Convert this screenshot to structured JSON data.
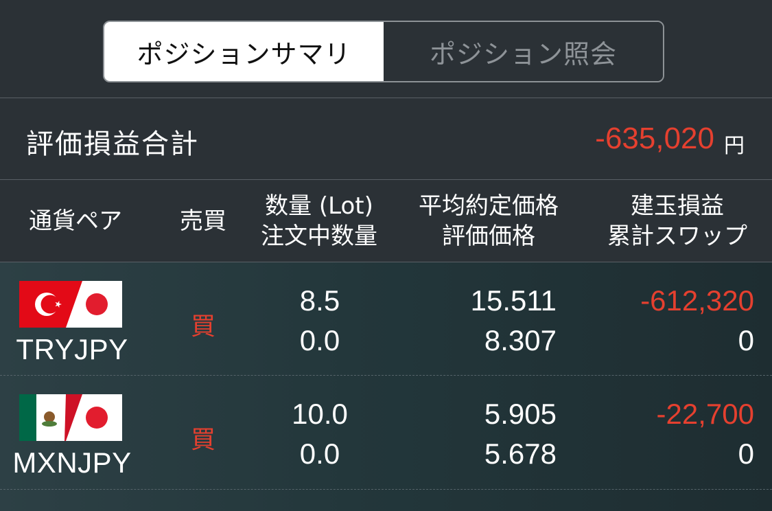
{
  "tabs": [
    {
      "label": "ポジションサマリ",
      "active": true
    },
    {
      "label": "ポジション照会",
      "active": false
    }
  ],
  "total": {
    "label": "評価損益合計",
    "value": "-635,020",
    "unit": "円"
  },
  "header": {
    "pair": "通貨ペア",
    "side": "売買",
    "qty_line1": "数量 (Lot)",
    "qty_line2": "注文中数量",
    "price_line1": "平均約定価格",
    "price_line2": "評価価格",
    "pl_line1": "建玉損益",
    "pl_line2": "累計スワップ"
  },
  "rows": [
    {
      "symbol": "TRYJPY",
      "flag_icon": "turkey-japan-flag-icon",
      "side": "買",
      "qty": "8.5",
      "pending_qty": "0.0",
      "avg_price": "15.511",
      "eval_price": "8.307",
      "pl": "-612,320",
      "swap": "0"
    },
    {
      "symbol": "MXNJPY",
      "flag_icon": "mexico-japan-flag-icon",
      "side": "買",
      "qty": "10.0",
      "pending_qty": "0.0",
      "avg_price": "5.905",
      "eval_price": "5.678",
      "pl": "-22,700",
      "swap": "0"
    }
  ],
  "colors": {
    "loss": "#e5402f",
    "background": "#2b3136",
    "turkey_red": "#e30a17",
    "japan_red": "#e21d2e",
    "mexico_green": "#006847",
    "mexico_red": "#ce1126"
  }
}
